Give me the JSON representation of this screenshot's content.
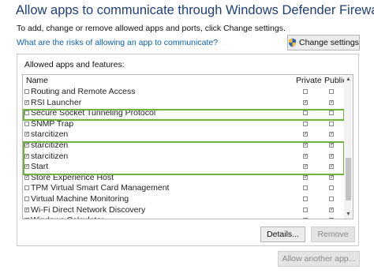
{
  "header": {
    "title": "Allow apps to communicate through Windows Defender Firewall",
    "description": "To add, change or remove allowed apps and ports, click Change settings.",
    "risk_link": "What are the risks of allowing an app to communicate?",
    "change_settings_label": "Change settings"
  },
  "apps_group": {
    "label": "Allowed apps and features:",
    "columns": {
      "name": "Name",
      "private": "Private",
      "public": "Public"
    },
    "rows": [
      {
        "name": "Routing and Remote Access",
        "enabled": false,
        "private": false,
        "public": false
      },
      {
        "name": "RSI Launcher",
        "enabled": true,
        "private": true,
        "public": true
      },
      {
        "name": "Secure Socket Tunneling Protocol",
        "enabled": false,
        "private": false,
        "public": false
      },
      {
        "name": "SNMP Trap",
        "enabled": false,
        "private": false,
        "public": false
      },
      {
        "name": "starcitizen",
        "enabled": true,
        "private": true,
        "public": true
      },
      {
        "name": "starcitizen",
        "enabled": true,
        "private": true,
        "public": true
      },
      {
        "name": "starcitizen",
        "enabled": true,
        "private": true,
        "public": true
      },
      {
        "name": "Start",
        "enabled": true,
        "private": true,
        "public": true
      },
      {
        "name": "Store Experience Host",
        "enabled": true,
        "private": true,
        "public": true
      },
      {
        "name": "TPM Virtual Smart Card Management",
        "enabled": false,
        "private": false,
        "public": false
      },
      {
        "name": "Virtual Machine Monitoring",
        "enabled": false,
        "private": false,
        "public": false
      },
      {
        "name": "Wi-Fi Direct Network Discovery",
        "enabled": true,
        "private": false,
        "public": true
      },
      {
        "name": "Windows Calculator",
        "enabled": true,
        "private": true,
        "public": true
      }
    ],
    "details_label": "Details...",
    "remove_label": "Remove"
  },
  "footer": {
    "allow_another_label": "Allow another app..."
  },
  "colors": {
    "title": "#1f3f78",
    "link": "#0a5fb4",
    "highlight": "#6eb43f",
    "disabled_text": "#8a8a8a"
  },
  "icons": {
    "change_settings": "uac-shield-icon",
    "scroll_up": "chevron-up-icon",
    "scroll_down": "chevron-down-icon"
  }
}
